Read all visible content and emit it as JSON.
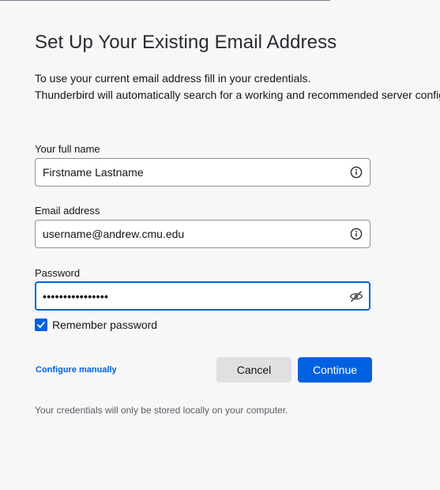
{
  "header": {
    "title": "Set Up Your Existing Email Address",
    "intro_line1": "To use your current email address fill in your credentials.",
    "intro_line2": "Thunderbird will automatically search for a working and recommended server configuration."
  },
  "form": {
    "full_name": {
      "label": "Your full name",
      "value": "Firstname Lastname",
      "icon": "info-icon"
    },
    "email": {
      "label": "Email address",
      "value": "username@andrew.cmu.edu",
      "icon": "info-icon"
    },
    "password": {
      "label": "Password",
      "value": "••••••••••••••••",
      "icon": "eye-slash-icon",
      "focused": true
    },
    "remember_password": {
      "label": "Remember password",
      "checked": true
    }
  },
  "actions": {
    "configure_manually": "Configure manually",
    "cancel": "Cancel",
    "continue": "Continue"
  },
  "footnote": "Your credentials will only be stored locally on your computer.",
  "colors": {
    "accent": "#0061e0",
    "background": "#f7f7f7",
    "cancel_button": "#e0e0e1"
  }
}
